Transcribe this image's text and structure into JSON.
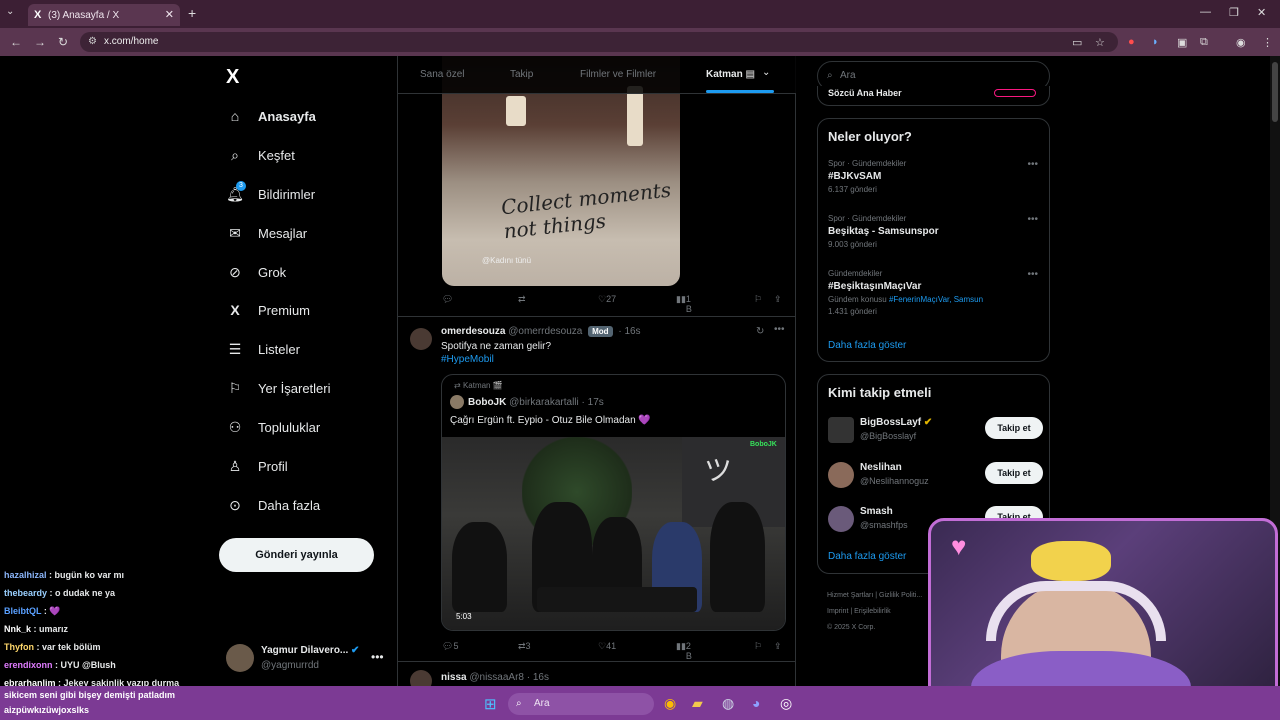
{
  "browser": {
    "tab_title": "(3) Anasayfa / X",
    "tab_favicon": "X",
    "url": "x.com/home",
    "colors": {
      "frame": "#3c1f34",
      "toolbar": "#5a3650"
    }
  },
  "nav": {
    "logo": "X",
    "items": [
      {
        "label": "Anasayfa",
        "icon": "home-icon",
        "active": true
      },
      {
        "label": "Keşfet",
        "icon": "search-icon"
      },
      {
        "label": "Bildirimler",
        "icon": "bell-icon",
        "badge": "3"
      },
      {
        "label": "Mesajlar",
        "icon": "mail-icon"
      },
      {
        "label": "Grok",
        "icon": "grok-icon"
      },
      {
        "label": "Premium",
        "icon": "x-premium-icon"
      },
      {
        "label": "Listeler",
        "icon": "list-icon"
      },
      {
        "label": "Yer İşaretleri",
        "icon": "bookmark-icon"
      },
      {
        "label": "Topluluklar",
        "icon": "communities-icon"
      },
      {
        "label": "Profil",
        "icon": "person-icon"
      },
      {
        "label": "Daha fazla",
        "icon": "more-circle-icon"
      }
    ],
    "post_button": "Gönderi yayınla",
    "account": {
      "name": "Yagmur Dilavero...",
      "handle": "@yagmurrdd"
    }
  },
  "timeline": {
    "tabs": [
      "Sana özel",
      "Takip",
      "Filmler ve Filmler",
      "Katman"
    ],
    "active_tab": "Katman",
    "tweet1": {
      "image_text": "Collect moments not things",
      "watermark": "@Kadını tünü",
      "retweets": "",
      "likes": "27",
      "views": "1 B"
    },
    "tweet2": {
      "name": "omerdesouza",
      "handle": "@omerrdesouza",
      "mod": "Mod",
      "time": "16s",
      "text": "Spotifya ne zaman gelir?",
      "hashtag": "#HypeMobil",
      "quote": {
        "context": "Katman",
        "name": "BoboJK",
        "handle": "@birkarakartalli",
        "time": "17s",
        "text": "Çağrı Ergün ft. Eypio - Otuz Bile Olmadan 💜",
        "video_tag": "BoboJK",
        "video_time": "5:03"
      },
      "replies": "5",
      "retweets": "3",
      "likes": "41",
      "views": "2 B"
    },
    "tweet3": {
      "name": "nissa",
      "handle": "@nissaaAr8",
      "time": "16s"
    }
  },
  "right": {
    "search_placeholder": "Ara",
    "top_snippet": "Sözcü Ana Haber",
    "trends_title": "Neler oluyor?",
    "trends": [
      {
        "category": "Spor · Gündemdekiler",
        "title": "#BJKvSAM",
        "count": "6.137 gönderi"
      },
      {
        "category": "Spor · Gündemdekiler",
        "title": "Beşiktaş - Samsunspor",
        "count": "9.003 gönderi"
      },
      {
        "category": "Gündemdekiler",
        "title": "#BeşiktaşınMaçıVar",
        "topic_prefix": "Gündem konusu",
        "topic_links": "#FenerinMaçıVar, Samsun",
        "count": "1.431 gönderi"
      }
    ],
    "trends_more": "Daha fazla göster",
    "who_title": "Kimi takip etmeli",
    "who": [
      {
        "name": "BigBossLayf",
        "handle": "@BigBosslayf",
        "verified": true,
        "button": "Takip et"
      },
      {
        "name": "Neslihan",
        "handle": "@Neslihannoguz",
        "button": "Takip et"
      },
      {
        "name": "Smash",
        "handle": "@smashfps",
        "button": "Takip et"
      }
    ],
    "who_more": "Daha fazla göster",
    "footer": [
      "Hizmet Şartları",
      "Gizlilik Politi...",
      "Imprint",
      "Erişilebilirlik",
      "© 2025 X Corp."
    ]
  },
  "chat": [
    {
      "user": "hazalhizal",
      "msg": "bugün ko var mı",
      "color": "#8ab4f8"
    },
    {
      "user": "thebeardy",
      "msg": "o dudak ne ya",
      "color": "#9ad0ff"
    },
    {
      "user": "BleibtQL",
      "msg": "💜",
      "color": "#5aa0ff"
    },
    {
      "user": "Nnk_k",
      "msg": "umarız",
      "color": "#ffffff"
    },
    {
      "user": "Thyfon",
      "msg": "var tek bölüm",
      "color": "#ffd86b"
    },
    {
      "user": "erendixonn",
      "msg": "UYU @Blush",
      "color": "#e07cff"
    },
    {
      "user": "ebrarhanlim",
      "msg": "Jekey sakinlik yazıp durma",
      "color": "#ffffff"
    }
  ],
  "taskbar": {
    "subtitle_line1": "sikicem seni gibi bişey demişti patladım",
    "subtitle_line2": "aizpüwkızüwjoxslks",
    "search": "Ara",
    "color": "#7c3a94"
  }
}
